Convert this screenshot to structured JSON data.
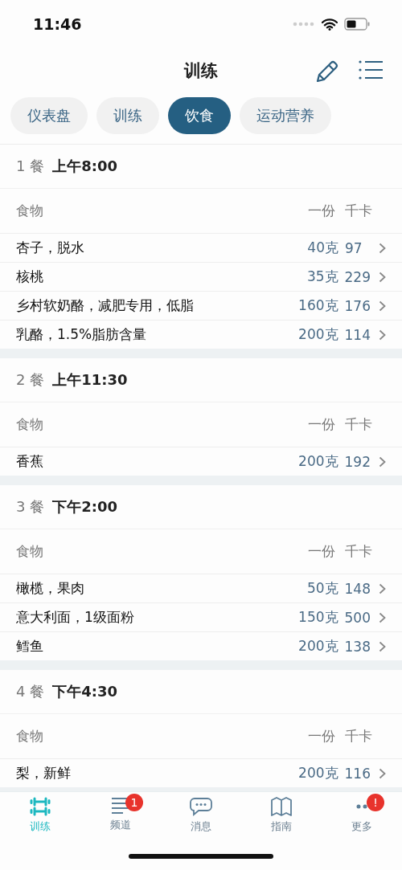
{
  "status_bar": {
    "time": "11:46"
  },
  "header": {
    "title": "训练"
  },
  "tabs": [
    {
      "label": "仪表盘",
      "selected": false
    },
    {
      "label": "训练",
      "selected": false
    },
    {
      "label": "饮食",
      "selected": true
    },
    {
      "label": "运动营养",
      "selected": false
    }
  ],
  "meals": [
    {
      "number": "1 餐",
      "time": "上午8:00",
      "columns": [
        "食物",
        "一份",
        "千卡"
      ],
      "rows": [
        {
          "food": "杏子，脱水",
          "serving": "40克",
          "kcal": "97"
        },
        {
          "food": "核桃",
          "serving": "35克",
          "kcal": "229"
        },
        {
          "food": "乡村软奶酪，减肥专用，低脂",
          "serving": "160克",
          "kcal": "176"
        },
        {
          "food": "乳酪，1.5%脂肪含量",
          "serving": "200克",
          "kcal": "114"
        }
      ]
    },
    {
      "number": "2 餐",
      "time": "上午11:30",
      "columns": [
        "食物",
        "一份",
        "千卡"
      ],
      "rows": [
        {
          "food": "香蕉",
          "serving": "200克",
          "kcal": "192"
        }
      ]
    },
    {
      "number": "3 餐",
      "time": "下午2:00",
      "columns": [
        "食物",
        "一份",
        "千卡"
      ],
      "rows": [
        {
          "food": "橄榄，果肉",
          "serving": "50克",
          "kcal": "148"
        },
        {
          "food": "意大利面，1级面粉",
          "serving": "150克",
          "kcal": "500"
        },
        {
          "food": "鳕鱼",
          "serving": "200克",
          "kcal": "138"
        }
      ]
    },
    {
      "number": "4 餐",
      "time": "下午4:30",
      "columns": [
        "食物",
        "一份",
        "千卡"
      ],
      "rows": [
        {
          "food": "梨，新鲜",
          "serving": "200克",
          "kcal": "116"
        }
      ]
    }
  ],
  "tab_bar": [
    {
      "kind": "dumbbell",
      "label": "训练",
      "selected": true
    },
    {
      "kind": "lines",
      "label": "频道",
      "selected": false,
      "badge": "1"
    },
    {
      "kind": "chat",
      "label": "消息",
      "selected": false
    },
    {
      "kind": "book",
      "label": "指南",
      "selected": false
    },
    {
      "kind": "dots",
      "label": "更多",
      "selected": false,
      "badge": "!"
    }
  ]
}
